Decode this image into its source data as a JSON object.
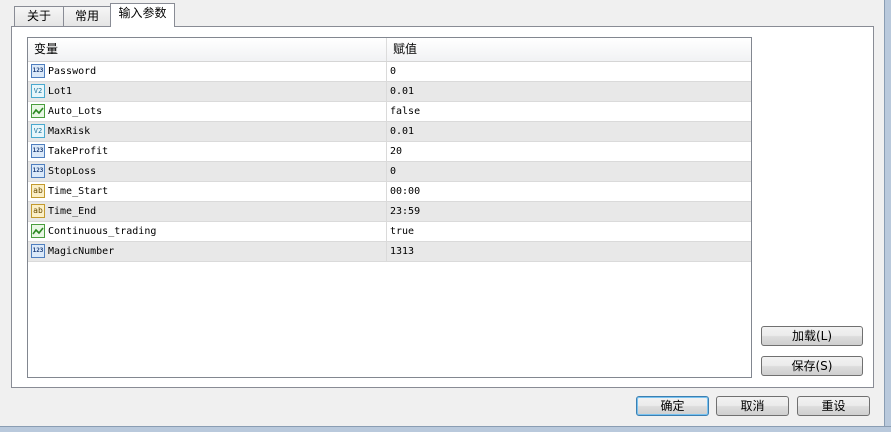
{
  "tabs": [
    "关于",
    "常用",
    "输入参数"
  ],
  "table": {
    "col_variable": "变量",
    "col_value": "赋值",
    "rows": [
      {
        "icon": "123-integer-icon",
        "icon_text": "123",
        "name": "Password",
        "value": "0"
      },
      {
        "icon": "v2-double-icon",
        "icon_text": "V2",
        "name": "Lot1",
        "value": "0.01"
      },
      {
        "icon": "boolean-chart-icon",
        "icon_text": "",
        "name": "Auto_Lots",
        "value": "false"
      },
      {
        "icon": "v2-double-icon",
        "icon_text": "V2",
        "name": "MaxRisk",
        "value": "0.01"
      },
      {
        "icon": "123-integer-icon",
        "icon_text": "123",
        "name": "TakeProfit",
        "value": "20"
      },
      {
        "icon": "123-integer-icon",
        "icon_text": "123",
        "name": "StopLoss",
        "value": "0"
      },
      {
        "icon": "ab-string-icon",
        "icon_text": "ab",
        "name": "Time_Start",
        "value": "00:00"
      },
      {
        "icon": "ab-string-icon",
        "icon_text": "ab",
        "name": "Time_End",
        "value": "23:59"
      },
      {
        "icon": "boolean-chart-icon",
        "icon_text": "",
        "name": "Continuous_trading",
        "value": "true"
      },
      {
        "icon": "123-integer-icon",
        "icon_text": "123",
        "name": "MagicNumber",
        "value": "1313"
      }
    ]
  },
  "side_buttons": {
    "load": "加载(L)",
    "save": "保存(S)"
  },
  "footer_buttons": {
    "ok": "确定",
    "cancel": "取消",
    "reset": "重设"
  }
}
